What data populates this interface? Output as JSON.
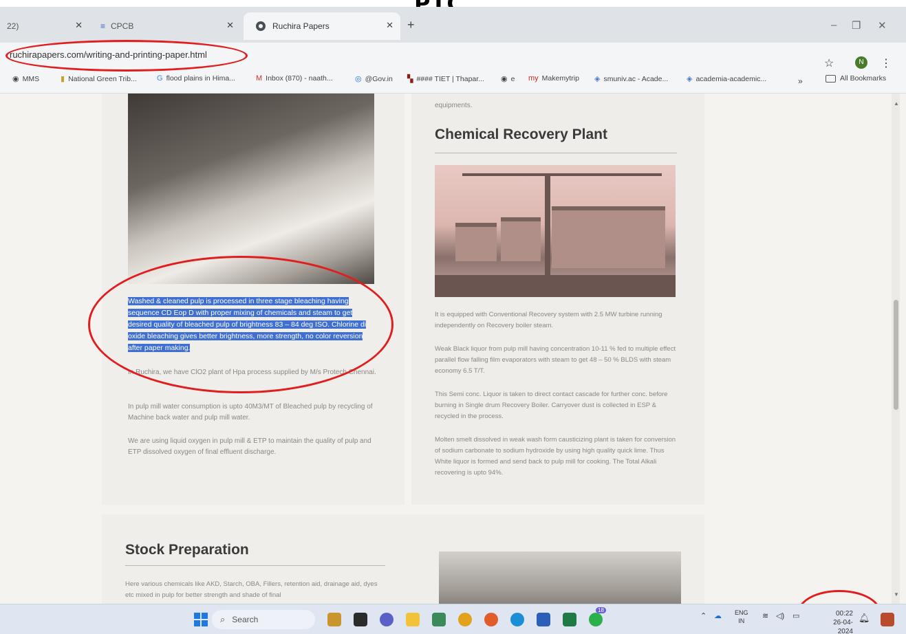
{
  "caption": {
    "partial_text": "PIC"
  },
  "browser": {
    "tabs": [
      {
        "label": "22)"
      },
      {
        "label": "CPCB"
      },
      {
        "label": "Ruchira Papers",
        "active": true
      }
    ],
    "new_tab": "+",
    "url": "ruchirapapers.com/writing-and-printing-paper.html",
    "profile_initial": "N",
    "bookmarks": [
      {
        "label": "MMS",
        "icon": "globe-icon"
      },
      {
        "label": "National Green Trib...",
        "icon": "bookmark-icon"
      },
      {
        "label": "flood plains in Hima...",
        "icon": "google-icon"
      },
      {
        "label": "Inbox (870) - naath...",
        "icon": "gmail-icon"
      },
      {
        "label": "@Gov.in",
        "icon": "gov-icon"
      },
      {
        "label": "#### TIET | Thapar...",
        "icon": "tiet-icon"
      },
      {
        "label": "e",
        "icon": "globe-icon"
      },
      {
        "label": "Makemytrip",
        "icon": "makemytrip-icon"
      },
      {
        "label": "smuniv.ac - Acade...",
        "icon": "diamond-icon"
      },
      {
        "label": "academia-academic...",
        "icon": "diamond-icon"
      }
    ],
    "bookmarks_overflow": "»",
    "all_bookmarks": "All Bookmarks"
  },
  "page": {
    "left": {
      "highlighted": "Washed & cleaned pulp is processed in three stage bleaching having sequence CD Eop D with proper mixing of chemicals and steam to get desired quality of bleached pulp of brightness 83 – 84 deg ISO. Chlorine di oxide bleaching gives better brightness, more strength, no color reversion after paper making.",
      "p1": "In Ruchira, we have ClO2 plant of Hpa process supplied by M/s Protech Chennai.",
      "p2": "In pulp mill water consumption is upto 40M3/MT of Bleached pulp by recycling of Machine back water and pulp mill water.",
      "p3": "We are using liquid oxygen in pulp mill & ETP to maintain the quality of pulp and ETP dissolved oxygen of final effluent discharge."
    },
    "right": {
      "top_fragment": "equipments.",
      "title": "Chemical Recovery Plant",
      "p1": "It is equipped with Conventional Recovery system with 2.5 MW turbine running independently on Recovery boiler steam.",
      "p2": "Weak Black liquor from pulp mill having concentration 10-11 % fed to multiple effect parallel flow falling film evaporators with steam to get 48 – 50 % BLDS with steam economy 6.5 T/T.",
      "p3": "This Semi conc. Liquor is taken to direct contact cascade for further conc. before burning in Single drum Recovery Boiler. Carryover dust is collected in ESP & recycled in the process.",
      "p4": "Molten smelt dissolved in weak wash form causticizing plant is taken for conversion of sodium carbonate to sodium hydroxide by using high quality quick lime. Thus White liquor is formed and send back to pulp mill for cooking. The Total Alkali recovering is upto 94%."
    },
    "stock": {
      "title": "Stock Preparation",
      "body": "Here various chemicals like AKD, Starch, OBA, Fillers, retention aid, drainage aid, dyes etc mixed in pulp for better strength and shade of final"
    }
  },
  "taskbar": {
    "search_placeholder": "Search",
    "notification_badge": "18",
    "lang_line1": "ENG",
    "lang_line2": "IN",
    "time": "00:22",
    "date": "26-04-2024"
  },
  "colors": {
    "selection": "#3f6fd1",
    "annotation": "#e01e1e",
    "heading": "#3a3a3a",
    "body_text": "#8a8784"
  }
}
